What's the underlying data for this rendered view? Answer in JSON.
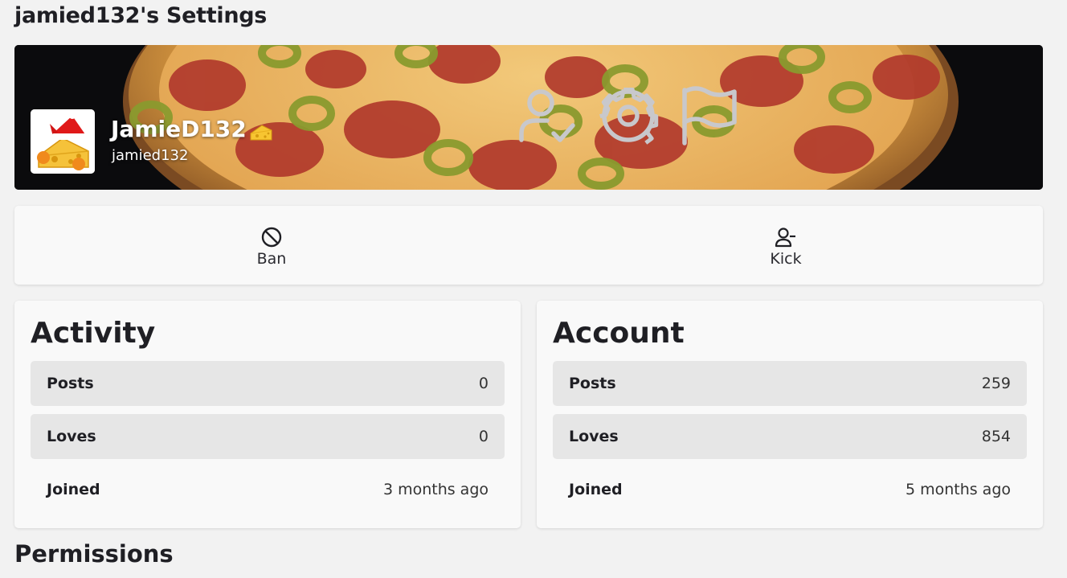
{
  "page": {
    "title": "jamied132's Settings"
  },
  "profile": {
    "display_name": "JamieD132",
    "username": "jamied132",
    "badge_icon": "cheese-icon",
    "avatar_icon": "cheese-with-santa-hat"
  },
  "banner_actions": [
    {
      "icon": "user-check-icon"
    },
    {
      "icon": "gear-icon"
    },
    {
      "icon": "flag-icon"
    }
  ],
  "actions": {
    "ban_label": "Ban",
    "kick_label": "Kick"
  },
  "activity": {
    "title": "Activity",
    "posts_label": "Posts",
    "posts_value": "0",
    "loves_label": "Loves",
    "loves_value": "0",
    "joined_label": "Joined",
    "joined_value": "3 months ago"
  },
  "account": {
    "title": "Account",
    "posts_label": "Posts",
    "posts_value": "259",
    "loves_label": "Loves",
    "loves_value": "854",
    "joined_label": "Joined",
    "joined_value": "5 months ago"
  },
  "permissions": {
    "title": "Permissions"
  },
  "colors": {
    "page_bg": "#f2f2f2",
    "card_bg": "#f9f9f9",
    "row_shade": "#e6e6e6",
    "text": "#1f1f24",
    "banner_icon": "#c8c8cc"
  }
}
